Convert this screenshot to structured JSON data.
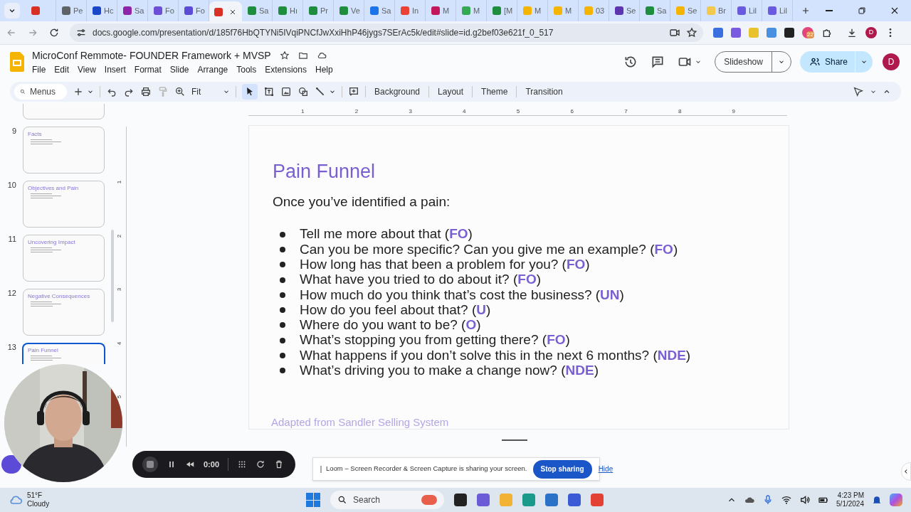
{
  "browser": {
    "tabs": [
      {
        "color": "#d93025",
        "selected": false
      },
      {
        "label": "Pe",
        "color": "#5f6368",
        "selected": false
      },
      {
        "label": "Hc",
        "color": "#1a47c8",
        "selected": false
      },
      {
        "label": "Sa",
        "color": "#8e24aa",
        "selected": false
      },
      {
        "label": "Fo",
        "color": "#6c4fd6",
        "selected": false
      },
      {
        "label": "Fo",
        "color": "#5b4bd6",
        "selected": false
      },
      {
        "color": "#d93025",
        "selected": true
      },
      {
        "label": "Sa",
        "color": "#1e8e3e",
        "selected": false
      },
      {
        "label": "Hı",
        "color": "#1e8e3e",
        "selected": false
      },
      {
        "label": "Pr",
        "color": "#1e8e3e",
        "selected": false
      },
      {
        "label": "Ve",
        "color": "#1e8e3e",
        "selected": false
      },
      {
        "label": "Sa",
        "color": "#1a73e8",
        "selected": false
      },
      {
        "label": "In",
        "color": "#ea4335",
        "selected": false
      },
      {
        "label": "M",
        "color": "#c2185b",
        "selected": false
      },
      {
        "label": "M",
        "color": "#34a853",
        "selected": false
      },
      {
        "label": "[M",
        "color": "#1e8e3e",
        "selected": false
      },
      {
        "label": "M",
        "color": "#f4b400",
        "selected": false
      },
      {
        "label": "M",
        "color": "#f4b400",
        "selected": false
      },
      {
        "label": "03",
        "color": "#f4b400",
        "selected": false
      },
      {
        "label": "Se",
        "color": "#5e35b1",
        "selected": false
      },
      {
        "label": "Sa",
        "color": "#1e8e3e",
        "selected": false
      },
      {
        "label": "Se",
        "color": "#f4b400",
        "selected": false
      },
      {
        "label": "Br",
        "color": "#f2c94c",
        "selected": false
      },
      {
        "label": "Lil",
        "color": "#6a5ae0",
        "selected": false
      },
      {
        "label": "Lil",
        "color": "#6a5ae0",
        "selected": false
      }
    ],
    "url": "docs.google.com/presentation/d/185f76HbQTYNi5IVqiPNCfJwXxiHhP46jygs7SErAc5k/edit#slide=id.g2bef03e621f_0_517",
    "extension_badge": "22",
    "profile": "D"
  },
  "doc": {
    "title": "MicroConf Remmote- FOUNDER Framework + MVSP",
    "menu": [
      "File",
      "Edit",
      "View",
      "Insert",
      "Format",
      "Slide",
      "Arrange",
      "Tools",
      "Extensions",
      "Help"
    ],
    "search_placeholder": "Menus",
    "zoom": "Fit",
    "toolbar_buttons": [
      "Background",
      "Layout",
      "Theme",
      "Transition"
    ],
    "slideshow": "Slideshow",
    "share": "Share",
    "avatar": "D"
  },
  "filmstrip": [
    {
      "number": "9",
      "title": "Facts",
      "selected": false
    },
    {
      "number": "10",
      "title": "Objectives and Pain",
      "selected": false
    },
    {
      "number": "11",
      "title": "Uncovering Impact",
      "selected": false
    },
    {
      "number": "12",
      "title": "Negative Consequences",
      "selected": false
    },
    {
      "number": "13",
      "title": "Pain Funnel",
      "selected": true
    }
  ],
  "ruler": {
    "horizontal": [
      "1",
      "2",
      "3",
      "4",
      "5",
      "6",
      "7",
      "8",
      "9"
    ],
    "vertical": [
      "1",
      "2",
      "3",
      "4",
      "5"
    ]
  },
  "slide": {
    "title": "Pain Funnel",
    "intro": "Once you’ve identified a pain:",
    "bullets": [
      "Tell me more about that (**FO**)",
      "Can you be more specific? Can you give me an example? (**FO**)",
      "How long has that been a problem for you? (**FO**)",
      "What have you tried to do about it? (**FO**)",
      "How much do you think that’s cost the business? (**UN**)",
      "How do you feel about that? (**U**)",
      "Where do you want to be? (**O**)",
      "What’s stopping you from getting there? (**FO**)",
      "What happens if you don’t solve this in the next 6 months? (**NDE**)",
      "What’s driving you to make a change now? (**NDE**)"
    ],
    "footer": "Adapted from Sandler Selling System"
  },
  "recorder": {
    "time": "0:00"
  },
  "share_notice": {
    "text": "Loom – Screen Recorder & Screen Capture is sharing your screen.",
    "stop": "Stop sharing",
    "hide": "Hide"
  },
  "taskbar": {
    "temperature": "51°F",
    "weather": "Cloudy",
    "search_placeholder": "Search",
    "time": "4:23 PM",
    "date": "5/1/2024"
  }
}
